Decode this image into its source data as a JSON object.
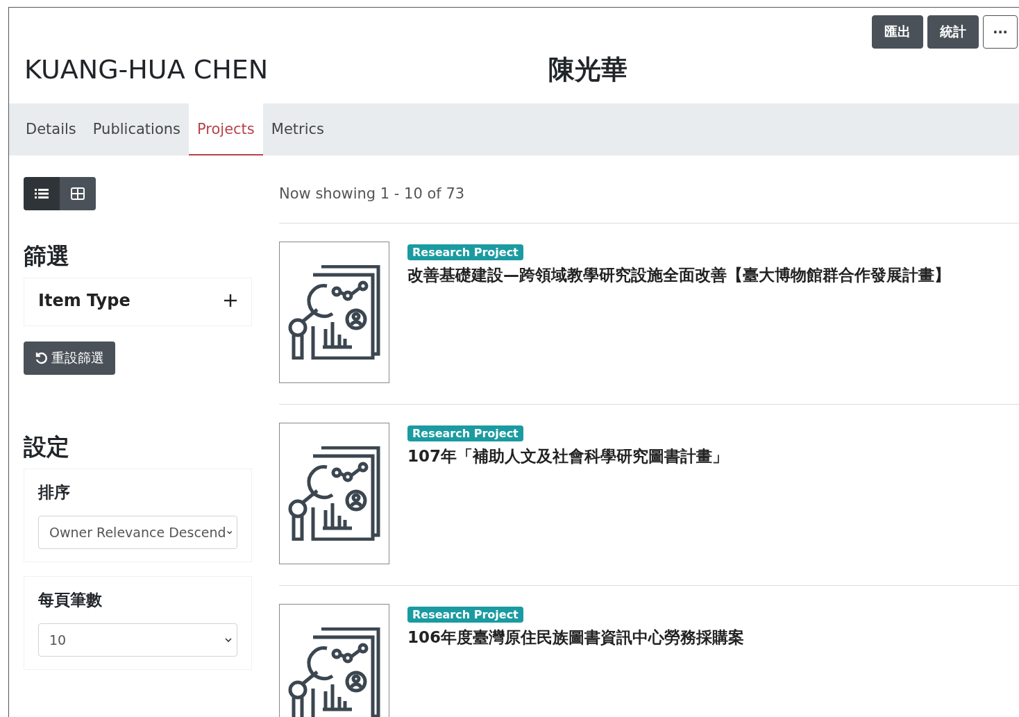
{
  "header_buttons": [
    {
      "kind": "text",
      "label": "匯出"
    },
    {
      "kind": "text",
      "label": "統計"
    },
    {
      "kind": "more",
      "label": "···"
    }
  ],
  "person": {
    "name_en": "KUANG-HUA CHEN",
    "name_zh": "陳光華"
  },
  "tabs": [
    {
      "label": "Details",
      "selected": false
    },
    {
      "label": "Publications",
      "selected": false
    },
    {
      "label": "Projects",
      "selected": true
    },
    {
      "label": "Metrics",
      "selected": false
    }
  ],
  "view_toggle": [
    {
      "kind": "list",
      "selected": true
    },
    {
      "kind": "grid",
      "selected": false
    }
  ],
  "filter": {
    "heading": "篩選",
    "groups": [
      {
        "label": "Item Type",
        "expanded": false
      }
    ],
    "reset_label": "重設篩選"
  },
  "settings": {
    "heading": "設定",
    "fields": [
      {
        "label": "排序",
        "value": "Owner Relevance Descend"
      },
      {
        "label": "每頁筆數",
        "value": "10"
      }
    ]
  },
  "results": {
    "summary": "Now showing 1 - 10 of 73",
    "items": [
      {
        "badge": "Research Project",
        "title": "改善基礎建設—跨領域教學研究設施全面改善【臺大博物館群合作發展計畫】"
      },
      {
        "badge": "Research Project",
        "title": "107年「補助人文及社會科學研究圖書計畫」"
      },
      {
        "badge": "Research Project",
        "title": "106年度臺灣原住民族圖書資訊中心勞務採購案"
      }
    ]
  }
}
